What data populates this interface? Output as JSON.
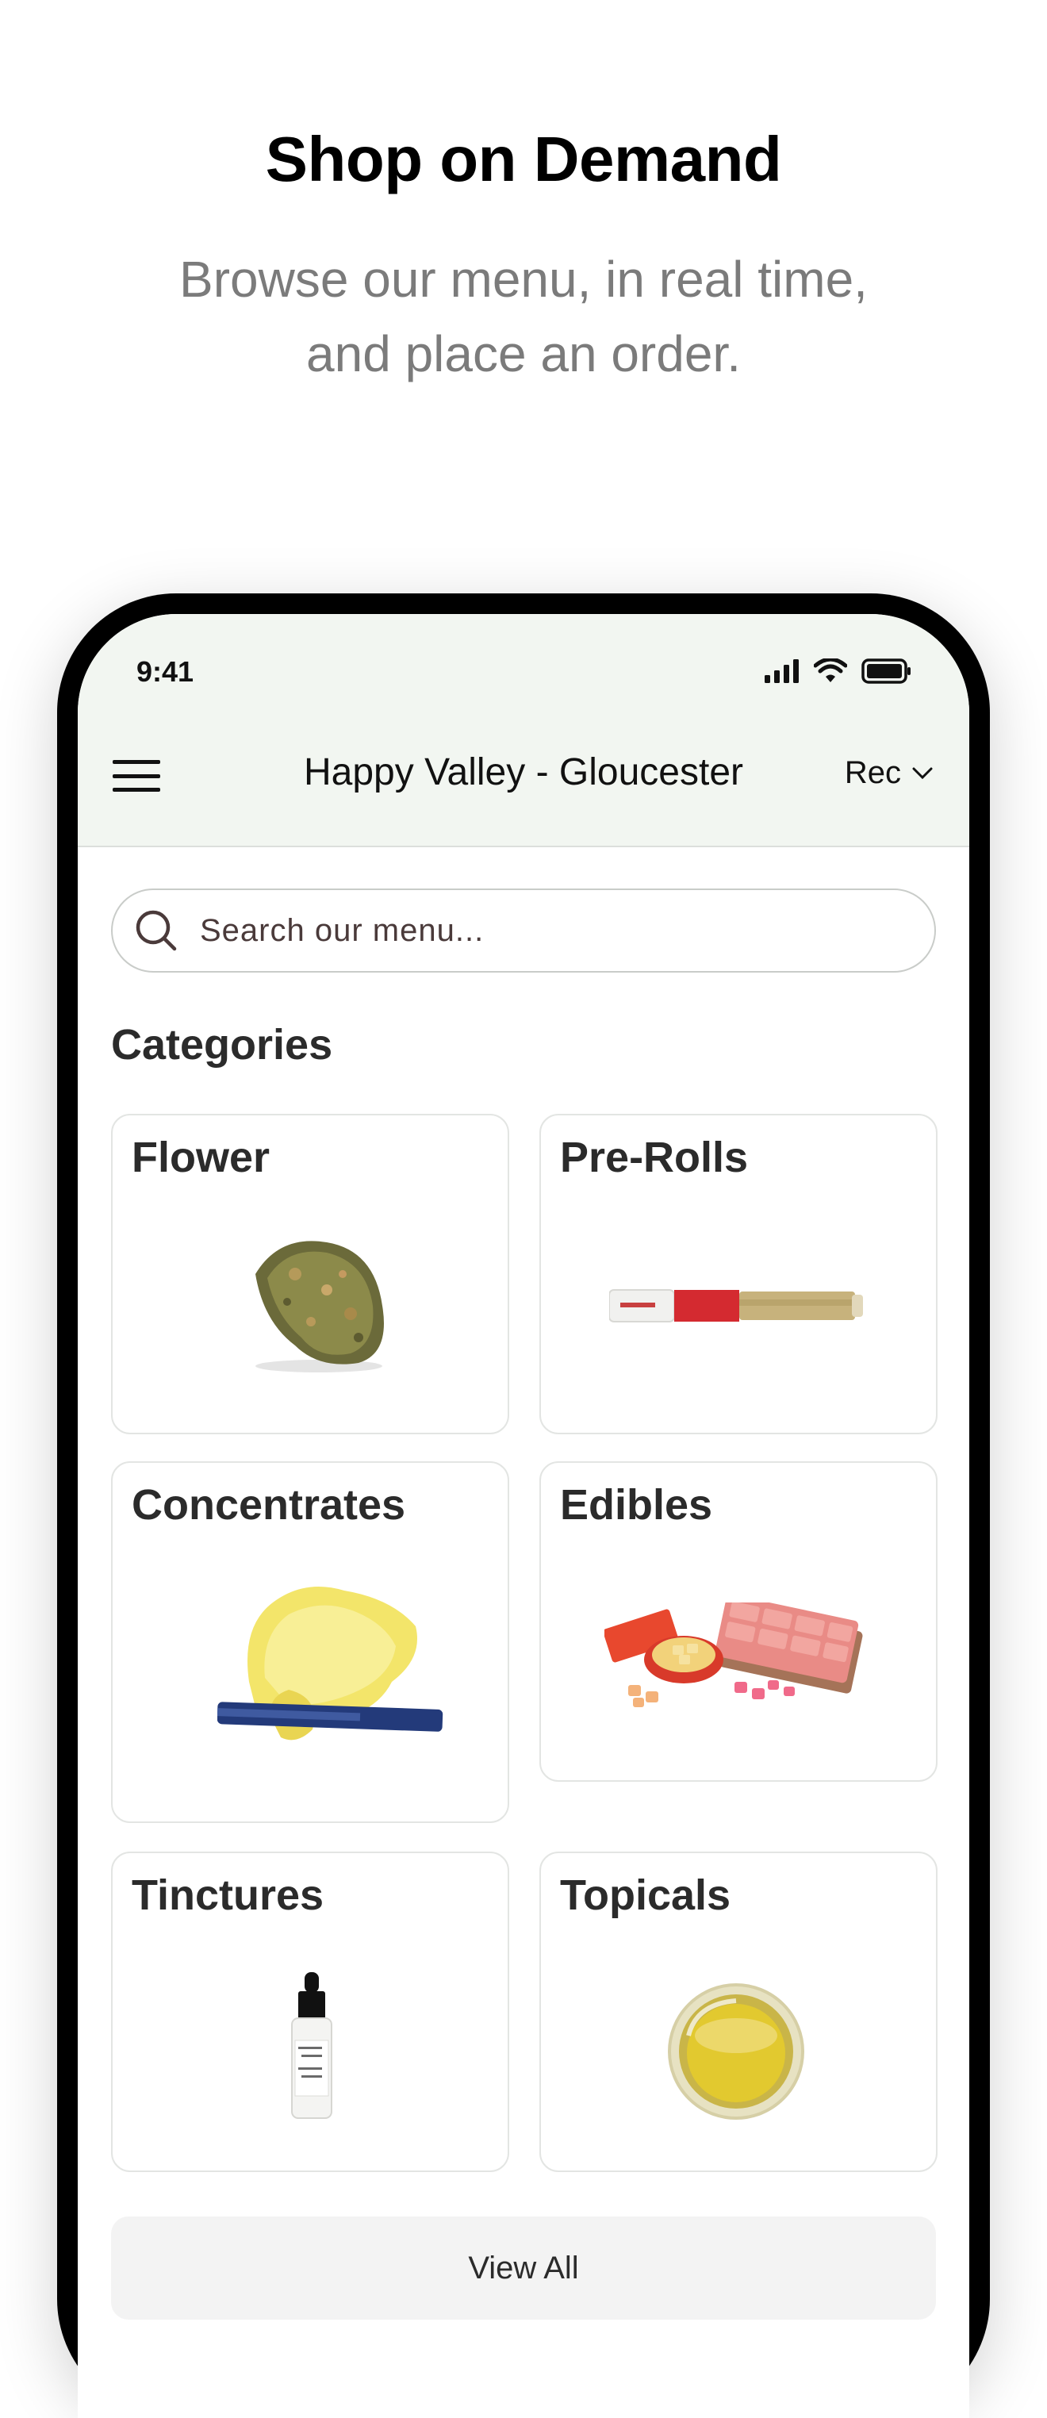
{
  "hero": {
    "title": "Shop on Demand",
    "subtitle_line1": "Browse our menu, in real time,",
    "subtitle_line2": "and place an order."
  },
  "status_bar": {
    "time": "9:41",
    "icons": [
      "signal-icon",
      "wifi-icon",
      "battery-icon"
    ]
  },
  "header": {
    "store_name": "Happy Valley - Gloucester",
    "mode_selected": "Rec",
    "menu_icon": "hamburger-icon"
  },
  "search": {
    "placeholder": "Search our menu..."
  },
  "categories": {
    "heading": "Categories",
    "items": [
      {
        "label": "Flower",
        "image": "cannabis-bud"
      },
      {
        "label": "Pre-Rolls",
        "image": "pre-roll-tube"
      },
      {
        "label": "Concentrates",
        "image": "concentrate-wax"
      },
      {
        "label": "Edibles",
        "image": "chocolate-and-gummies"
      },
      {
        "label": "Tinctures",
        "image": "dropper-bottle"
      },
      {
        "label": "Topicals",
        "image": "balm-jar"
      }
    ],
    "view_all_label": "View All"
  },
  "colors": {
    "header_bg": "#f2f6f1",
    "text_dark": "#2b2b2b",
    "subtitle_gray": "#7b7b7b",
    "card_border": "#e3e5e3"
  }
}
